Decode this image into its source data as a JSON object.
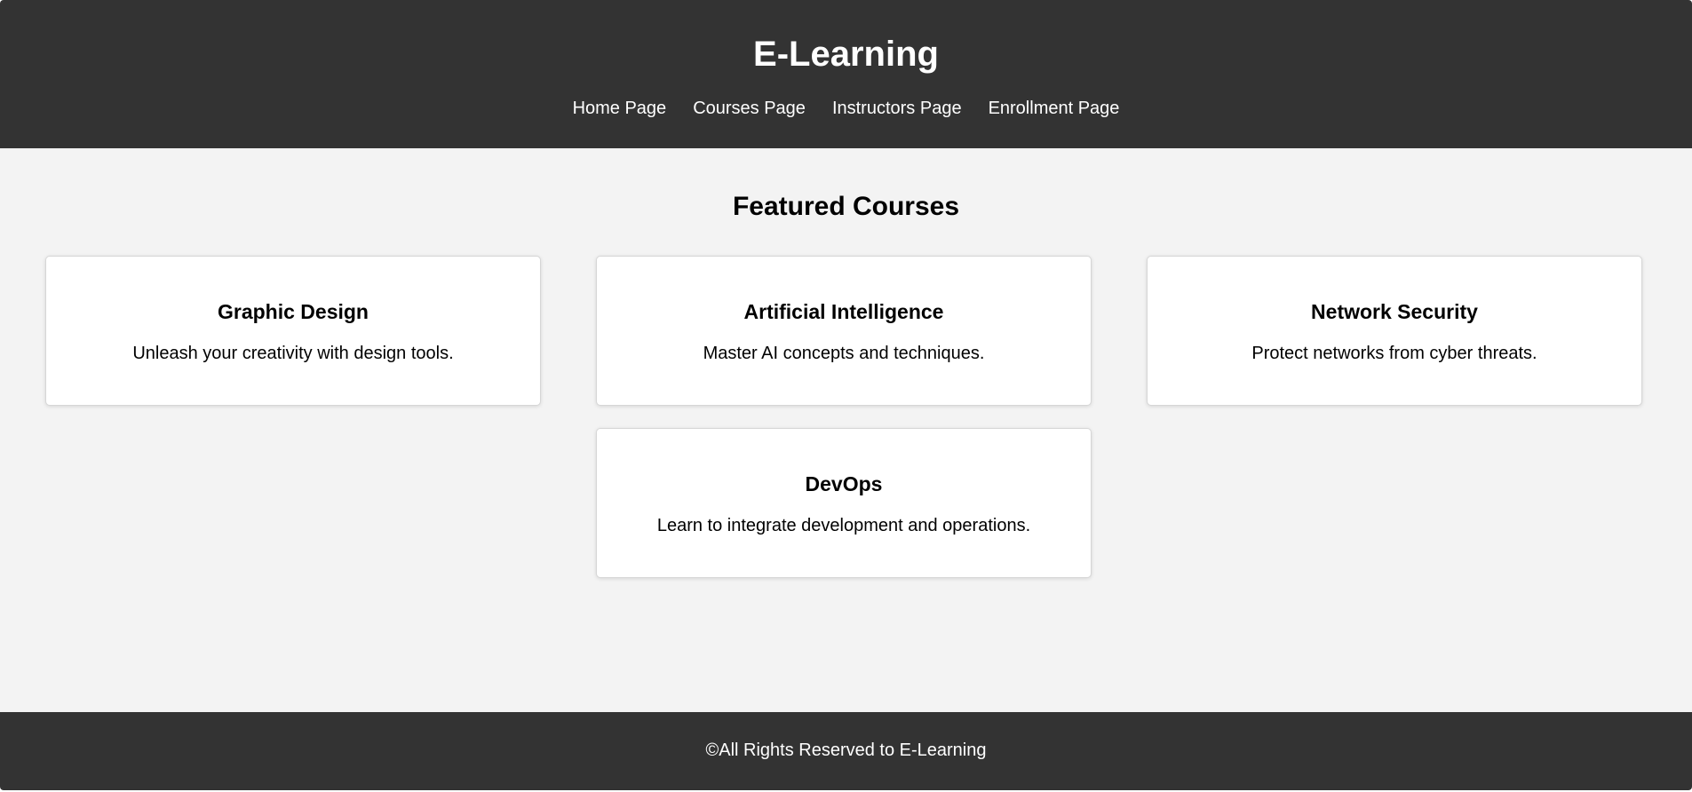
{
  "header": {
    "site_title": "E-Learning",
    "nav": [
      {
        "label": "Home Page"
      },
      {
        "label": "Courses Page"
      },
      {
        "label": "Instructors Page"
      },
      {
        "label": "Enrollment Page"
      }
    ]
  },
  "main": {
    "section_title": "Featured Courses",
    "courses": [
      {
        "title": "Graphic Design",
        "description": "Unleash your creativity with design tools."
      },
      {
        "title": "Artificial Intelligence",
        "description": "Master AI concepts and techniques."
      },
      {
        "title": "Network Security",
        "description": "Protect networks from cyber threats."
      },
      {
        "title": "DevOps",
        "description": "Learn to integrate development and operations."
      }
    ]
  },
  "footer": {
    "text": "©All Rights Reserved to E-Learning"
  },
  "colors": {
    "header_bg": "#333333",
    "page_bg": "#f3f3f3",
    "card_bg": "#ffffff",
    "header_text": "#ffffff"
  }
}
